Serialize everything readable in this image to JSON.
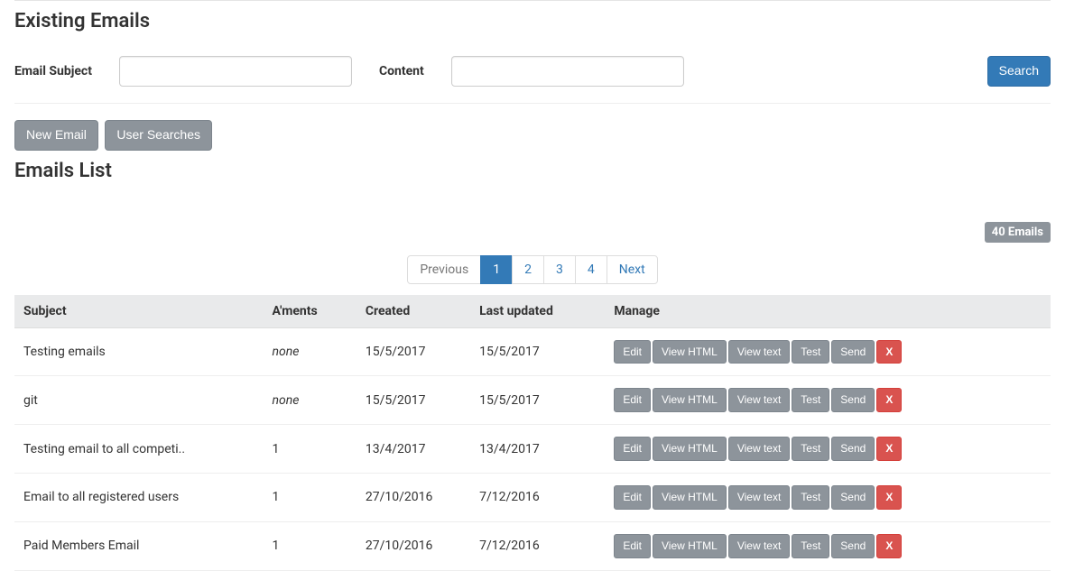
{
  "page": {
    "title": "Existing Emails",
    "list_title": "Emails List"
  },
  "search": {
    "subject_label": "Email Subject",
    "subject_value": "",
    "content_label": "Content",
    "content_value": "",
    "search_button": "Search"
  },
  "actions": {
    "new_email": "New Email",
    "user_searches": "User Searches"
  },
  "count_badge": "40 Emails",
  "pagination": {
    "previous": "Previous",
    "next": "Next",
    "pages": [
      "1",
      "2",
      "3",
      "4"
    ],
    "active": "1"
  },
  "table": {
    "headers": {
      "subject": "Subject",
      "aments": "A'ments",
      "created": "Created",
      "updated": "Last updated",
      "manage": "Manage"
    },
    "manage_buttons": {
      "edit": "Edit",
      "view_html": "View HTML",
      "view_text": "View text",
      "test": "Test",
      "send": "Send",
      "delete": "X"
    },
    "rows": [
      {
        "subject": "Testing emails",
        "aments": "none",
        "aments_italic": true,
        "created": "15/5/2017",
        "updated": "15/5/2017"
      },
      {
        "subject": "git",
        "aments": "none",
        "aments_italic": true,
        "created": "15/5/2017",
        "updated": "15/5/2017"
      },
      {
        "subject": "Testing email to all competi..",
        "aments": "1",
        "aments_italic": false,
        "created": "13/4/2017",
        "updated": "13/4/2017"
      },
      {
        "subject": "Email to all registered users",
        "aments": "1",
        "aments_italic": false,
        "created": "27/10/2016",
        "updated": "7/12/2016"
      },
      {
        "subject": "Paid Members Email",
        "aments": "1",
        "aments_italic": false,
        "created": "27/10/2016",
        "updated": "7/12/2016"
      }
    ]
  }
}
